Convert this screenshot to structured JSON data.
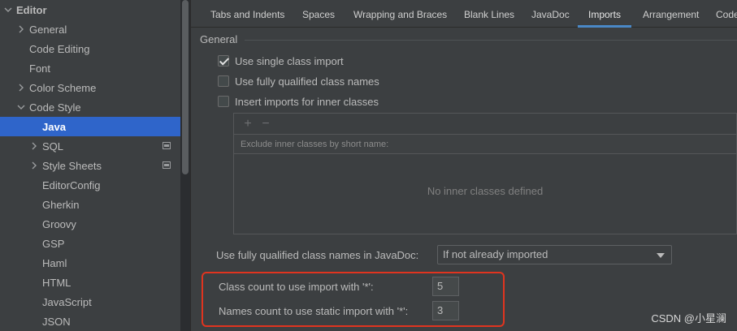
{
  "sidebar": {
    "items": [
      {
        "label": "Editor",
        "chevron": "down",
        "bold": true
      },
      {
        "label": "General",
        "chevron": "right"
      },
      {
        "label": "Code Editing",
        "chevron": ""
      },
      {
        "label": "Font",
        "chevron": ""
      },
      {
        "label": "Color Scheme",
        "chevron": "right"
      },
      {
        "label": "Code Style",
        "chevron": "down"
      },
      {
        "label": "Java",
        "chevron": "",
        "selected": true
      },
      {
        "label": "SQL",
        "chevron": "right",
        "scope_icon": true
      },
      {
        "label": "Style Sheets",
        "chevron": "right",
        "scope_icon": true
      },
      {
        "label": "EditorConfig",
        "chevron": ""
      },
      {
        "label": "Gherkin",
        "chevron": ""
      },
      {
        "label": "Groovy",
        "chevron": ""
      },
      {
        "label": "GSP",
        "chevron": ""
      },
      {
        "label": "Haml",
        "chevron": ""
      },
      {
        "label": "HTML",
        "chevron": ""
      },
      {
        "label": "JavaScript",
        "chevron": ""
      },
      {
        "label": "JSON",
        "chevron": ""
      }
    ]
  },
  "tabs": [
    {
      "label": "Tabs and Indents"
    },
    {
      "label": "Spaces"
    },
    {
      "label": "Wrapping and Braces"
    },
    {
      "label": "Blank Lines"
    },
    {
      "label": "JavaDoc"
    },
    {
      "label": "Imports",
      "active": true
    },
    {
      "label": "Arrangement"
    },
    {
      "label": "Code"
    }
  ],
  "general": {
    "title": "General",
    "use_single_class_import": {
      "label": "Use single class import",
      "checked": true
    },
    "use_fully_qualified": {
      "label": "Use fully qualified class names",
      "checked": false
    },
    "insert_imports_inner": {
      "label": "Insert imports for inner classes",
      "checked": false
    }
  },
  "inner_classes_panel": {
    "add_icon": "plus-icon",
    "remove_icon": "minus-icon",
    "header": "Exclude inner classes by short name:",
    "empty_text": "No inner classes defined"
  },
  "javadoc": {
    "label": "Use fully qualified class names in JavaDoc:",
    "selected": "If not already imported"
  },
  "class_count": {
    "label": "Class count to use import with '*':",
    "value": "5"
  },
  "names_count": {
    "label": "Names count to use static import with '*':",
    "value": "3"
  },
  "colors": {
    "accent": "#2f65ca",
    "highlight": "#e0341f"
  },
  "watermark": "CSDN @小星澜"
}
